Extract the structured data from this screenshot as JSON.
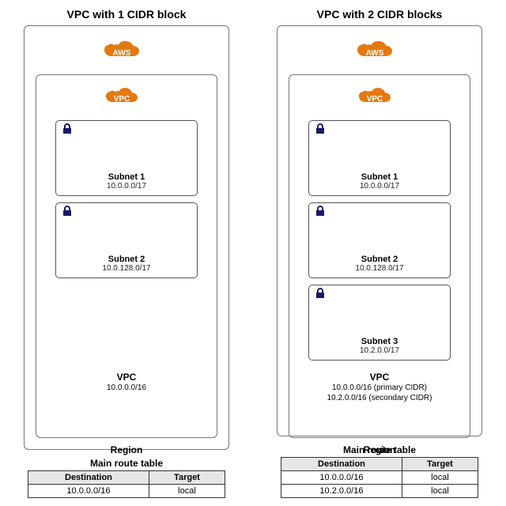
{
  "left": {
    "title": "VPC with 1 CIDR block",
    "aws_label": "AWS",
    "vpc_badge": "VPC",
    "subnets": [
      {
        "name": "Subnet 1",
        "cidr": "10.0.0.0/17"
      },
      {
        "name": "Subnet 2",
        "cidr": "10.0.128.0/17"
      }
    ],
    "vpc_label": "VPC",
    "vpc_cidrs": "10.0.0.0/16",
    "region_label": "Region",
    "route_table": {
      "title": "Main route table",
      "headers": {
        "dest": "Destination",
        "target": "Target"
      },
      "rows": [
        {
          "dest": "10.0.0.0/16",
          "target": "local"
        }
      ]
    }
  },
  "right": {
    "title": "VPC with 2 CIDR blocks",
    "aws_label": "AWS",
    "vpc_badge": "VPC",
    "subnets": [
      {
        "name": "Subnet 1",
        "cidr": "10.0.0.0/17"
      },
      {
        "name": "Subnet 2",
        "cidr": "10.0.128.0/17"
      },
      {
        "name": "Subnet 3",
        "cidr": "10.2.0.0/17"
      }
    ],
    "vpc_label": "VPC",
    "vpc_cidrs": "10.0.0.0/16 (primary CIDR)\n10.2.0.0/16 (secondary CIDR)",
    "region_label": "Region",
    "route_table": {
      "title": "Main route table",
      "headers": {
        "dest": "Destination",
        "target": "Target"
      },
      "rows": [
        {
          "dest": "10.0.0.0/16",
          "target": "local"
        },
        {
          "dest": "10.2.0.0/16",
          "target": "local"
        }
      ]
    }
  }
}
